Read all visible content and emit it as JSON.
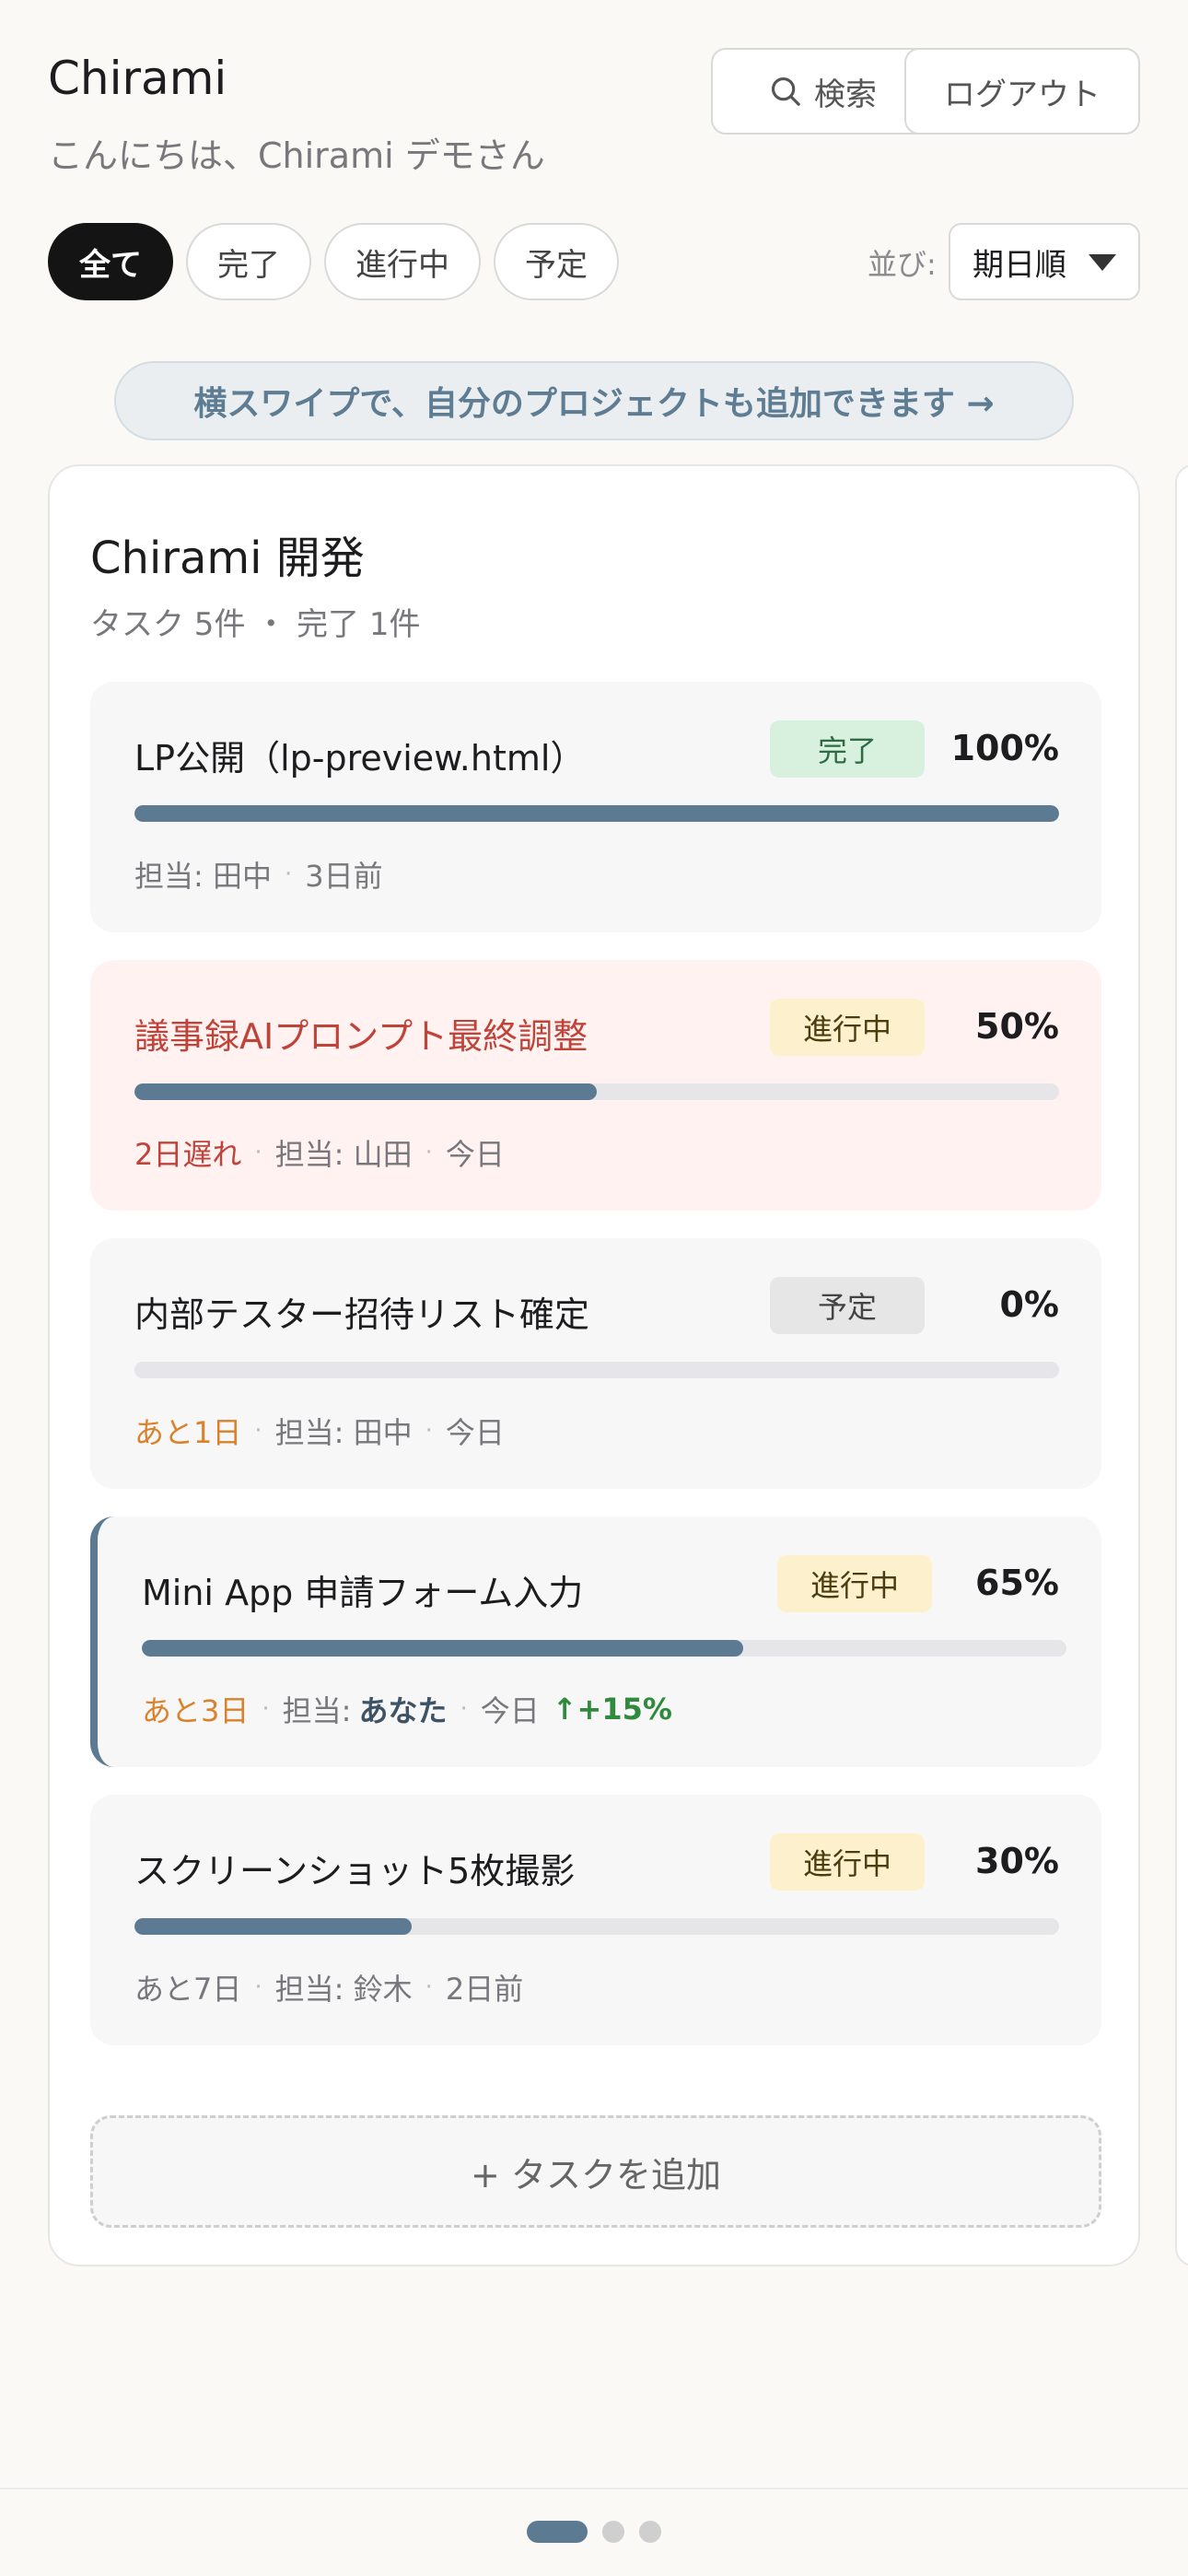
{
  "header": {
    "app_title": "Chirami",
    "greeting": "こんにちは、Chirami デモさん",
    "search_label": "検索",
    "logout_label": "ログアウト"
  },
  "filters": {
    "chips": [
      {
        "label": "全て",
        "active": true
      },
      {
        "label": "完了",
        "active": false
      },
      {
        "label": "進行中",
        "active": false
      },
      {
        "label": "予定",
        "active": false
      }
    ],
    "sort_label": "並び:",
    "sort_value": "期日順"
  },
  "hint": "横スワイプで、自分のプロジェクトも追加できます →",
  "project": {
    "title": "Chirami 開発",
    "meta": "タスク 5件 ・ 完了 1件",
    "tasks": [
      {
        "title": "LP公開（lp-preview.html）",
        "status": "完了",
        "percent": "100%",
        "progress": 1.0,
        "assignee_label": "担当:",
        "assignee": "田中",
        "updated": "3日前"
      },
      {
        "title": "議事録AIプロンプト最終調整",
        "status": "進行中",
        "percent": "50%",
        "progress": 0.5,
        "due": "2日遅れ",
        "assignee_label": "担当:",
        "assignee": "山田",
        "updated": "今日"
      },
      {
        "title": "内部テスター招待リスト確定",
        "status": "予定",
        "percent": "0%",
        "progress": 0.0,
        "due": "あと1日",
        "assignee_label": "担当:",
        "assignee": "田中",
        "updated": "今日"
      },
      {
        "title": "Mini App 申請フォーム入力",
        "status": "進行中",
        "percent": "65%",
        "progress": 0.65,
        "due": "あと3日",
        "assignee_label": "担当:",
        "assignee": "あなた",
        "updated": "今日",
        "delta": "↑+15%"
      },
      {
        "title": "スクリーンショット5枚撮影",
        "status": "進行中",
        "percent": "30%",
        "progress": 0.3,
        "due": "あと7日",
        "assignee_label": "担当:",
        "assignee": "鈴木",
        "updated": "2日前"
      }
    ],
    "add_task_label": "+ タスクを追加"
  },
  "pager": {
    "pages": 3,
    "current": 1
  },
  "colors": {
    "accent": "#5d7a93",
    "overdue": "#c0433a",
    "due_soon": "#d9822b",
    "delta": "#2f8a3e",
    "done_badge": "#d8f1df",
    "progress_badge": "#fdf1cd",
    "planned_badge": "#e6e6e6"
  }
}
